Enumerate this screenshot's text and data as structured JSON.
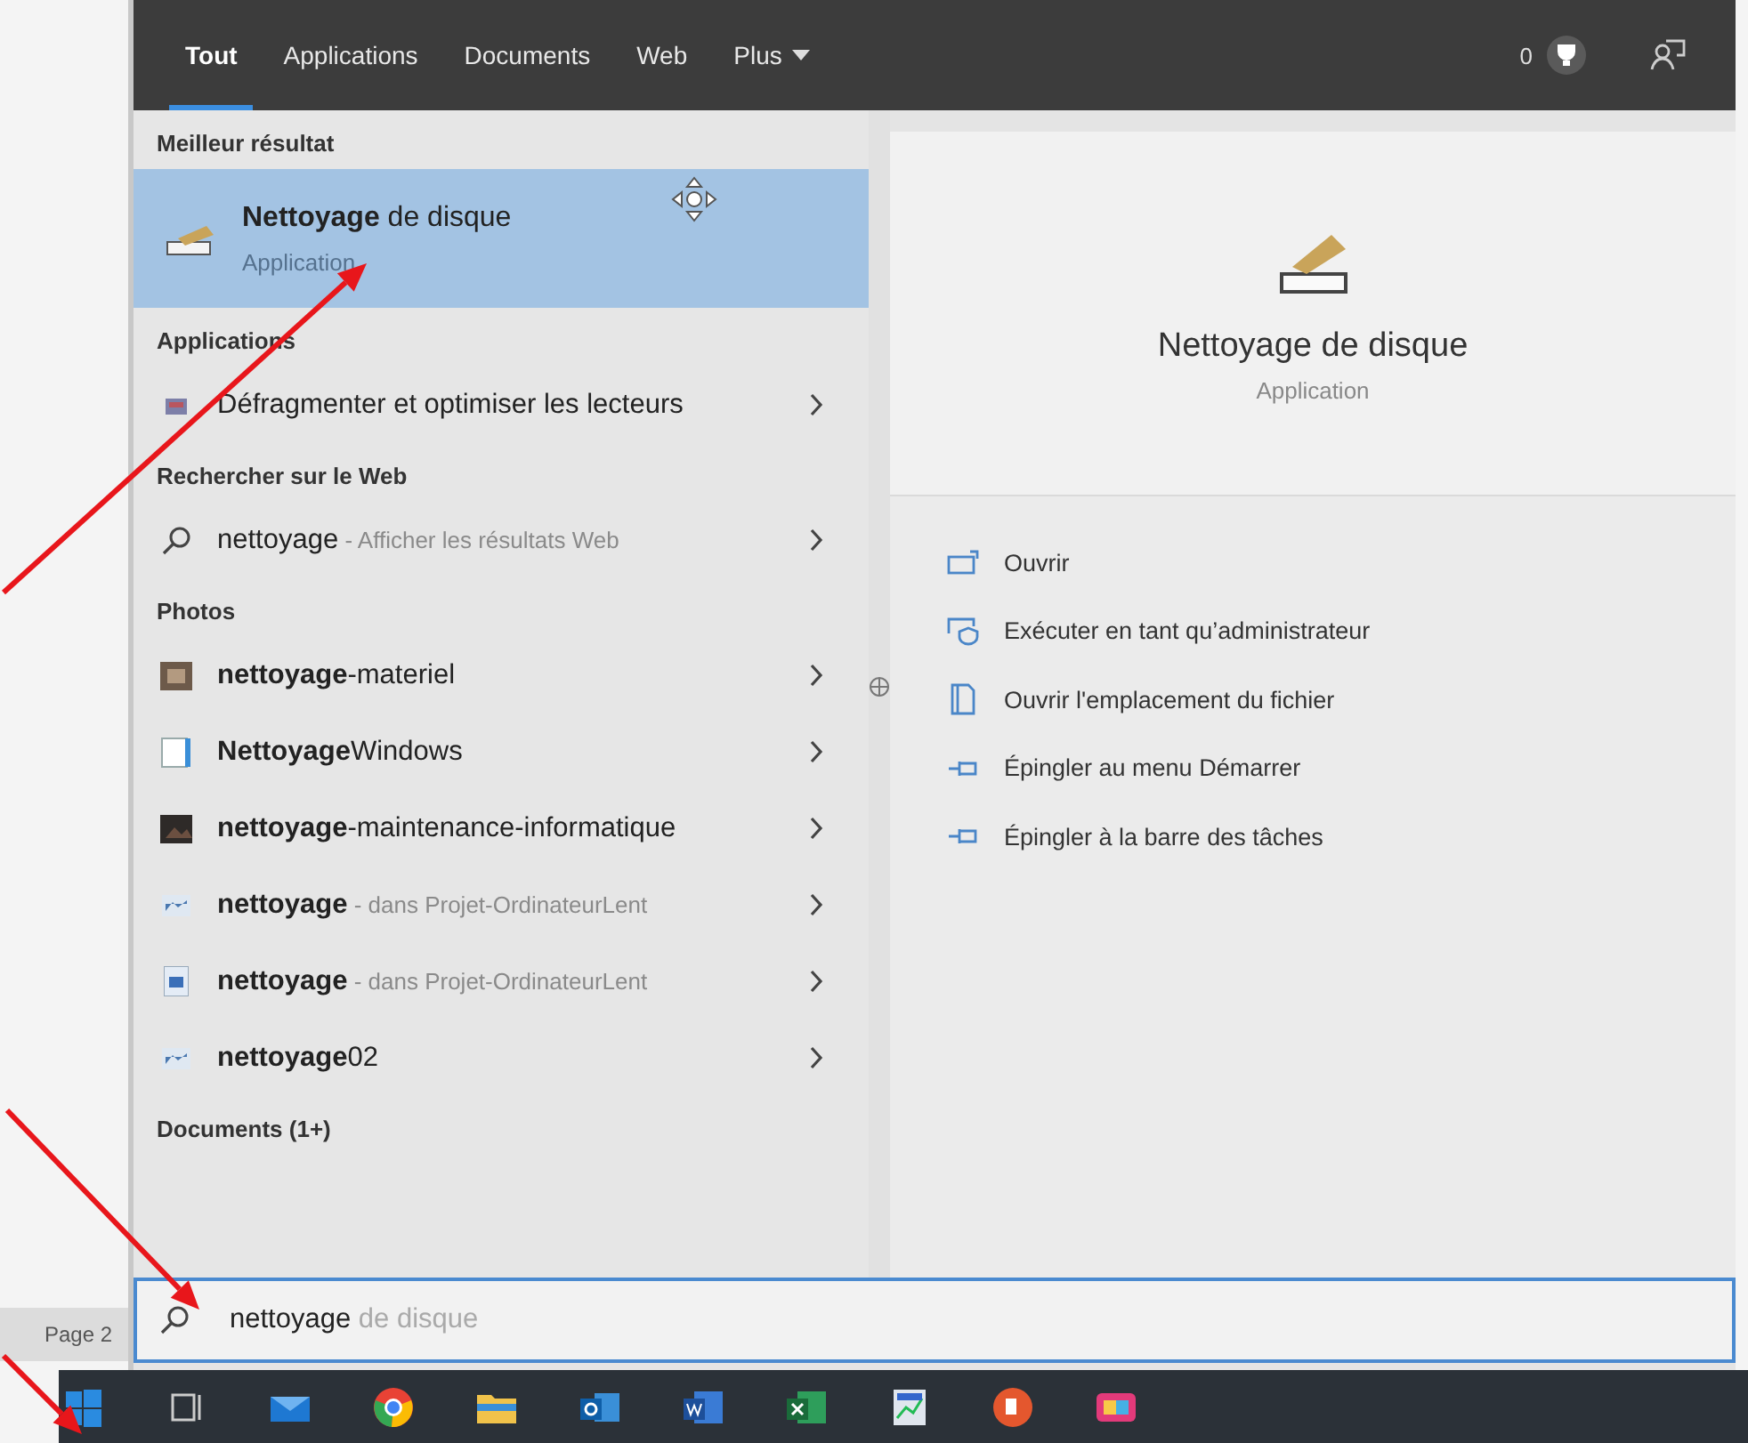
{
  "tabs": [
    {
      "label": "Tout",
      "selected": true,
      "dropdown": false
    },
    {
      "label": "Applications",
      "selected": false,
      "dropdown": false
    },
    {
      "label": "Documents",
      "selected": false,
      "dropdown": false
    },
    {
      "label": "Web",
      "selected": false,
      "dropdown": false
    },
    {
      "label": "Plus",
      "selected": false,
      "dropdown": true
    }
  ],
  "reward_count": "0",
  "best_match": {
    "heading": "Meilleur résultat",
    "title": "**Nettoyage** de disque",
    "subtitle": "Application",
    "selected": true
  },
  "sections": [
    {
      "heading": "Applications",
      "items": [
        {
          "kind": "defrag",
          "title": "Défragmenter et optimiser les lecteurs"
        }
      ]
    },
    {
      "heading": "Rechercher sur le Web",
      "items": [
        {
          "kind": "web",
          "title": "nettoyage",
          "detail": " - Afficher les résultats Web"
        }
      ]
    },
    {
      "heading": "Photos",
      "items": [
        {
          "kind": "photo",
          "title": "**nettoyage**-materiel"
        },
        {
          "kind": "window",
          "title": "**Nettoyage**Windows"
        },
        {
          "kind": "dark-photo",
          "title": "**nettoyage**-maintenance-informatique"
        },
        {
          "kind": "picture",
          "title": "**nettoyage**",
          "detail": " - dans Projet-OrdinateurLent"
        },
        {
          "kind": "word",
          "title": "**nettoyage**",
          "detail": " - dans Projet-OrdinateurLent"
        },
        {
          "kind": "picture",
          "title": "**nettoyage**02"
        }
      ]
    },
    {
      "heading": "Documents (1+)"
    }
  ],
  "preview": {
    "title": "Nettoyage de disque",
    "subtitle": "Application",
    "actions": [
      {
        "kind": "open",
        "label": "Ouvrir"
      },
      {
        "kind": "admin",
        "label": "Exécuter en tant qu’administrateur"
      },
      {
        "kind": "folder",
        "label": "Ouvrir l'emplacement du fichier"
      },
      {
        "kind": "pin",
        "label": "Épingler au menu Démarrer"
      },
      {
        "kind": "pin",
        "label": "Épingler à la barre des tâches"
      }
    ]
  },
  "search": {
    "query": "nettoyage",
    "suggestion": "de disque"
  },
  "page_label": "Page 2"
}
